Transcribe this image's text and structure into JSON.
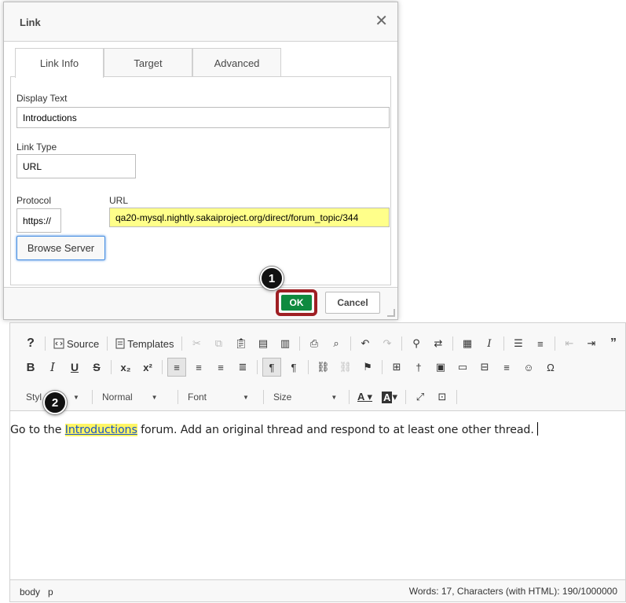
{
  "dialog": {
    "title": "Link",
    "close_glyph": "✕",
    "tabs": [
      {
        "label": "Link Info",
        "active": true
      },
      {
        "label": "Target",
        "active": false
      },
      {
        "label": "Advanced",
        "active": false
      }
    ],
    "display_text": {
      "label": "Display Text",
      "value": "Introductions"
    },
    "link_type": {
      "label": "Link Type",
      "value": "URL"
    },
    "protocol": {
      "label": "Protocol",
      "value": "https://"
    },
    "url": {
      "label": "URL",
      "value": "qa20-mysql.nightly.sakaiproject.org/direct/forum_topic/344",
      "highlight_color": "#ffff8a"
    },
    "browse_button": "Browse Server",
    "ok_button": "OK",
    "cancel_button": "Cancel",
    "ok_color": "#0e8a3f",
    "ok_ring_color": "#9f1f24"
  },
  "callouts": [
    "1",
    "2"
  ],
  "toolbar": {
    "row1": {
      "help": "?",
      "source": "Source",
      "templates": "Templates",
      "icons": [
        "cut-icon",
        "copy-icon",
        "paste-icon",
        "paste-text-icon",
        "paste-word-icon",
        "print-icon",
        "find-icon",
        "undo-icon",
        "redo-icon",
        "search-icon",
        "replace-icon",
        "select-all-icon",
        "remove-format-icon",
        "numbered-list-icon",
        "bulleted-list-icon",
        "outdent-icon",
        "indent-icon",
        "blockquote-icon",
        "div-icon"
      ]
    },
    "row2": {
      "bold": "B",
      "italic": "I",
      "underline": "U",
      "strike": "S",
      "subscript": "x₂",
      "superscript": "x²"
    },
    "row3": {
      "styles": "Styl",
      "format": "Normal",
      "font": "Font",
      "size": "Size"
    }
  },
  "content": {
    "before": "Go to the ",
    "link_text": "Introductions",
    "after": " forum. Add an original thread and respond to at least one other thread.",
    "link_highlight": "#fff566"
  },
  "status": {
    "path": [
      "body",
      "p"
    ],
    "counter": "Words: 17, Characters (with HTML): 190/1000000"
  }
}
